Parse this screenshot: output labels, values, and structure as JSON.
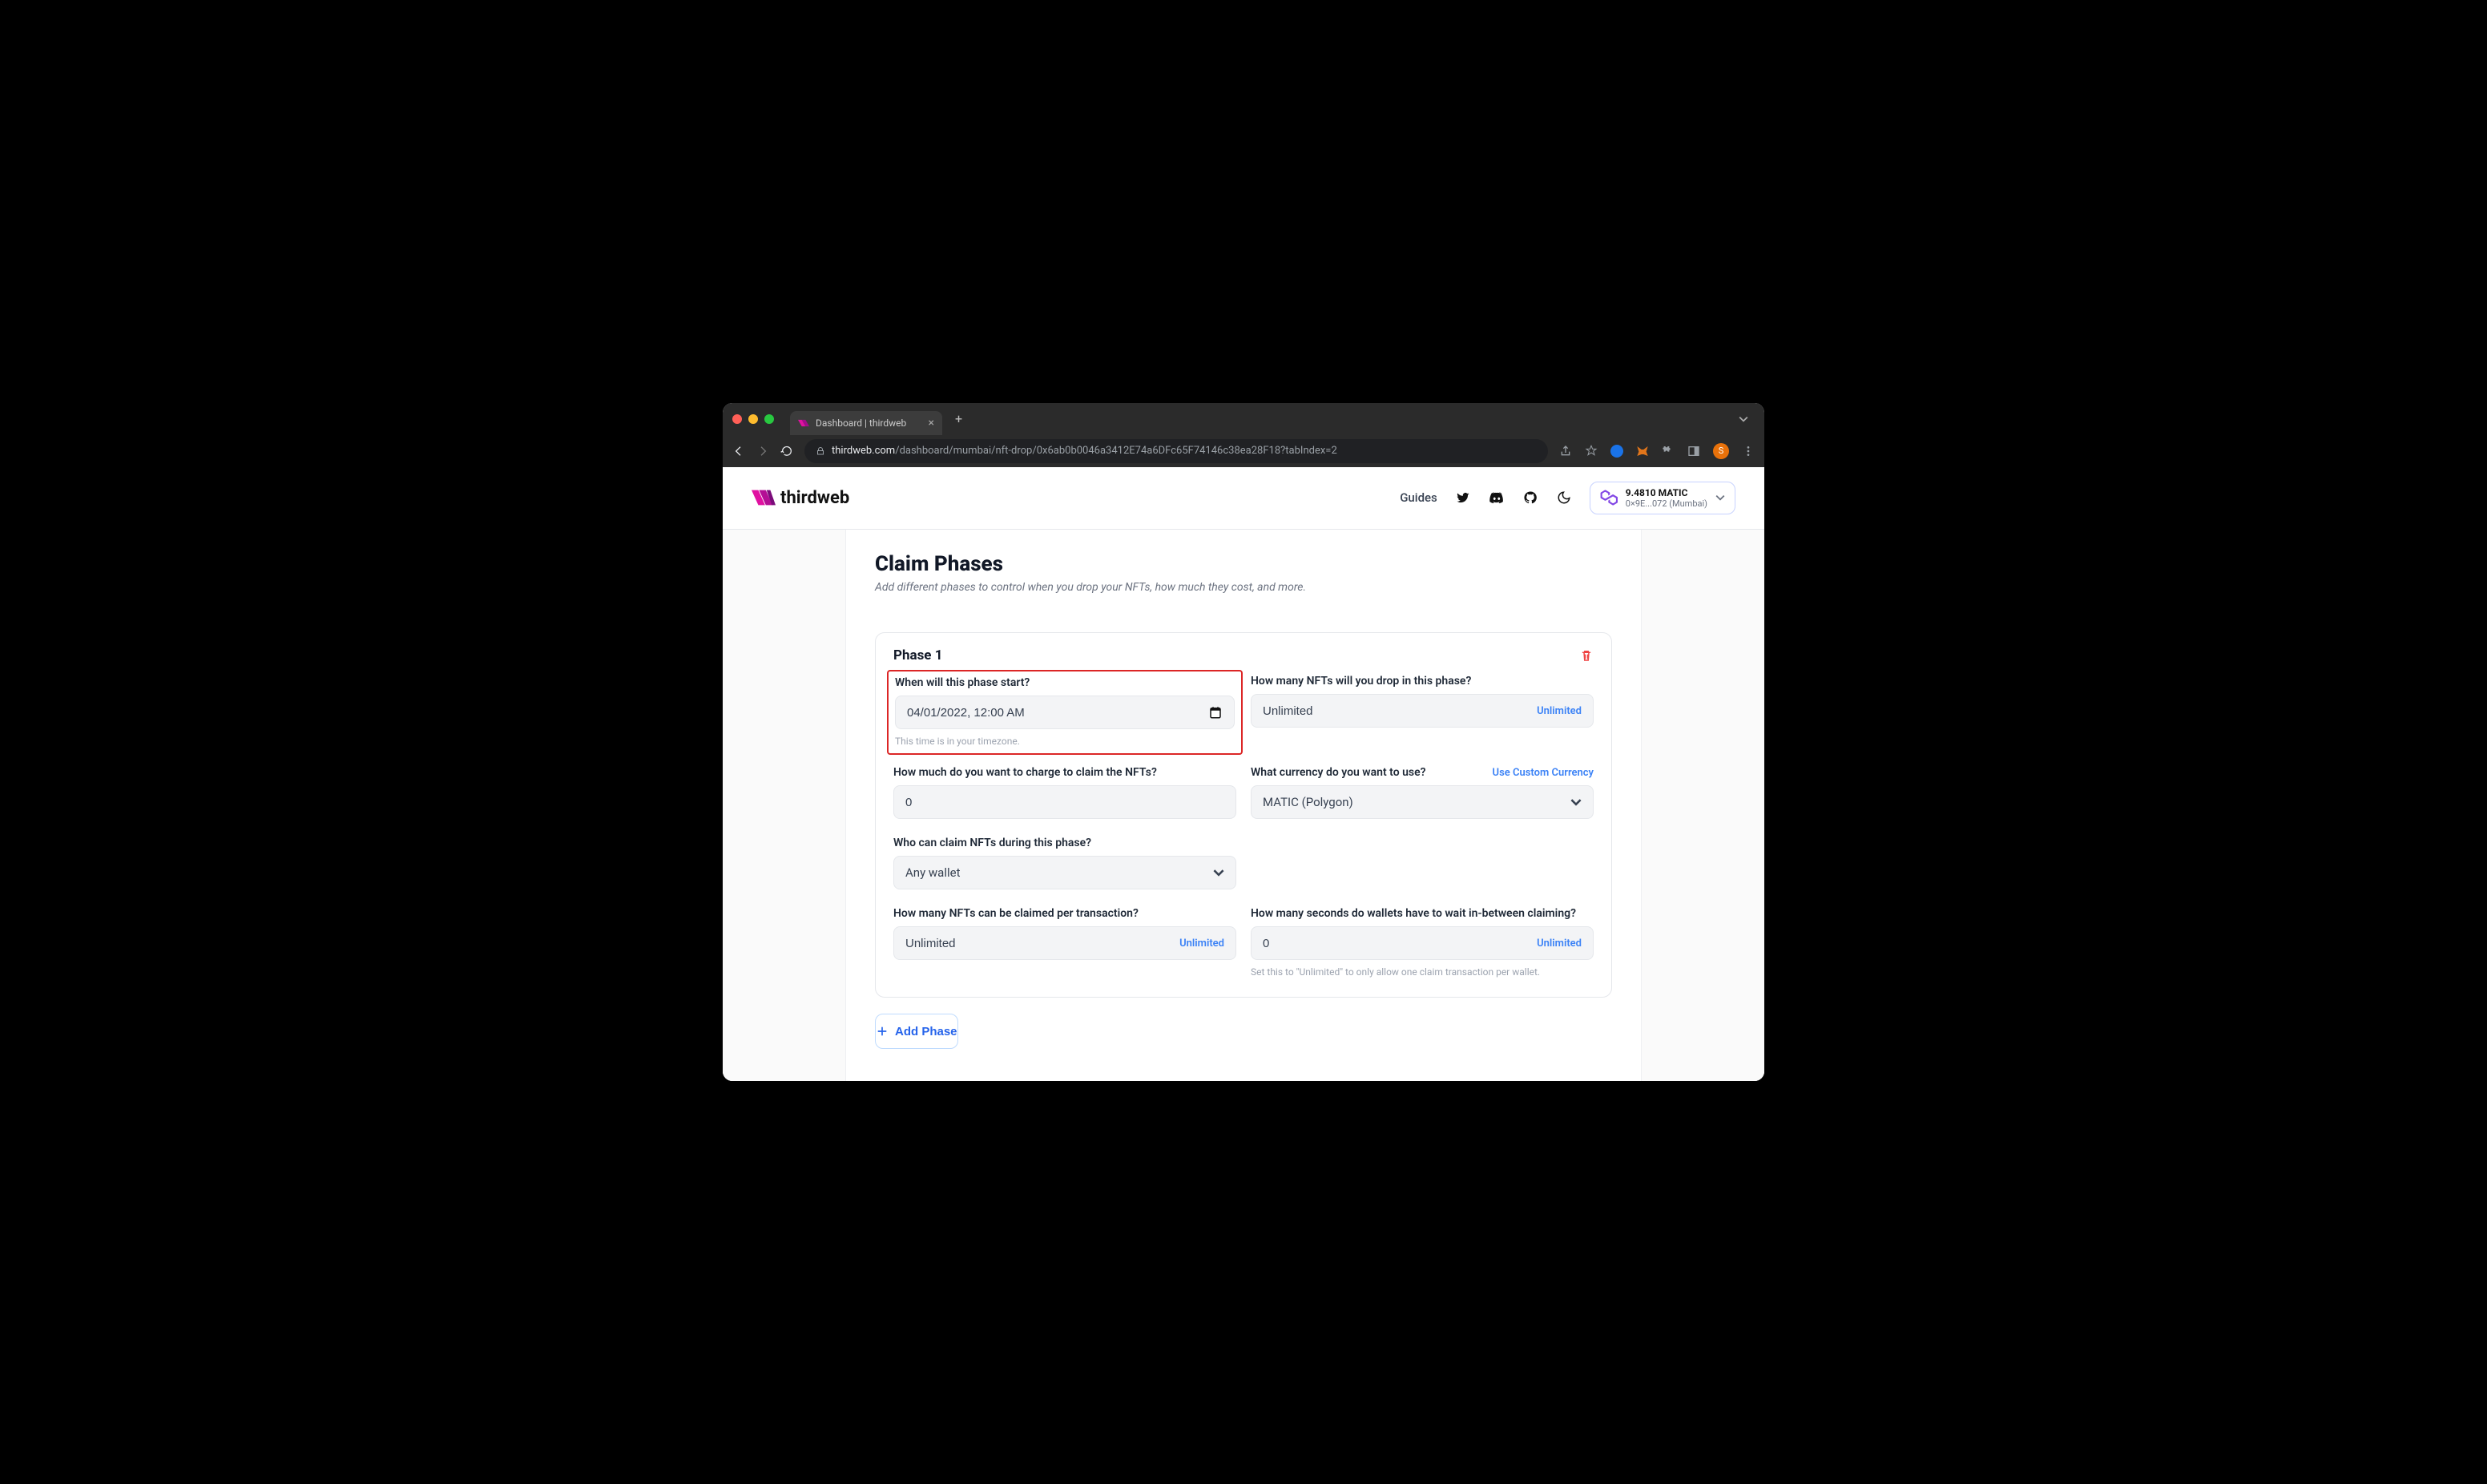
{
  "browser": {
    "tab_title": "Dashboard | thirdweb",
    "url_host": "thirdweb.com",
    "url_path": "/dashboard/mumbai/nft-drop/0x6ab0b0046a3412E74a6DFc65F74146c38ea28F18?tabIndex=2",
    "profile_initial": "S"
  },
  "header": {
    "brand": "thirdweb",
    "guides": "Guides",
    "wallet": {
      "balance": "9.4810 MATIC",
      "address": "0×9E...072 (Mumbai)"
    }
  },
  "page": {
    "title": "Claim Phases",
    "subtitle": "Add different phases to control when you drop your NFTs, how much they cost, and more."
  },
  "phase": {
    "title": "Phase 1",
    "start": {
      "label": "When will this phase start?",
      "value": "04/01/2022, 12:00 AM",
      "hint": "This time is in your timezone."
    },
    "dropCount": {
      "label": "How many NFTs will you drop in this phase?",
      "value": "Unlimited",
      "suffix": "Unlimited"
    },
    "price": {
      "label": "How much do you want to charge to claim the NFTs?",
      "value": "0"
    },
    "currency": {
      "label": "What currency do you want to use?",
      "link": "Use Custom Currency",
      "value": "MATIC (Polygon)"
    },
    "claimers": {
      "label": "Who can claim NFTs during this phase?",
      "value": "Any wallet"
    },
    "perTx": {
      "label": "How many NFTs can be claimed per transaction?",
      "value": "Unlimited",
      "suffix": "Unlimited"
    },
    "wait": {
      "label": "How many seconds do wallets have to wait in-between claiming?",
      "value": "0",
      "suffix": "Unlimited",
      "hint": "Set this to \"Unlimited\" to only allow one claim transaction per wallet."
    }
  },
  "add_phase": "Add Phase"
}
